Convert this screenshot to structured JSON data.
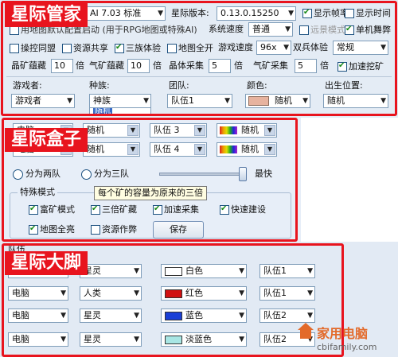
{
  "section1": {
    "badge": "星际管家",
    "row1": {
      "version_select": "AI 7.03 标准",
      "sc_version_label": "星际版本:",
      "sc_version_value": "0.13.0.15250",
      "show_fps": "显示帧率",
      "show_time": "显示时间"
    },
    "row2": {
      "hidden_text": "用地图默认配置启动 (用于RPG地图或特殊AI)",
      "system_speed_label": "系统速度",
      "system_speed_value": "普通",
      "distant_view": "远景模式",
      "single_machine": "单机舞弊"
    },
    "row3": {
      "macro": "操控同盟",
      "resource_share": "资源共享",
      "three_race": "三族体验",
      "map_full_open": "地图全开",
      "game_speed_label": "游戏速度",
      "game_speed_value": "96x",
      "double_soldier_label": "双兵体验",
      "double_soldier_value": "常规"
    },
    "row4": {
      "mineral_label": "晶矿蕴藏",
      "mineral_value": "10",
      "gas_label": "气矿蕴藏",
      "gas_value": "10",
      "crystal_collect_label": "晶体采集",
      "crystal_collect_value": "5",
      "gas_collect_label": "气矿采集",
      "gas_collect_value": "5",
      "times": "倍",
      "speed_mining": "加速挖矿"
    },
    "row5": {
      "player_label": "游戏者:",
      "player_value": "游戏者",
      "race_label": "种族:",
      "race_value": "神族",
      "team_label": "团队:",
      "team_value": "队伍1",
      "color_label": "颜色:",
      "color_value": "随机",
      "spawn_label": "出生位置:",
      "spawn_value": "随机",
      "popup_fragment": "随机"
    }
  },
  "section2": {
    "badge": "星际盒子",
    "rows": [
      {
        "player": "电脑",
        "race": "随机",
        "team": "队伍 3",
        "color": "随机"
      },
      {
        "player": "电脑",
        "race": "随机",
        "team": "队伍 4",
        "color": "随机"
      }
    ],
    "radio_two": "分为两队",
    "radio_three": "分为三队",
    "slider_max": "最快",
    "special_mode": "特殊模式",
    "tooltip": "每个矿的容量为原来的三倍",
    "rich_mine": "富矿模式",
    "triple_mine": "三倍矿藏",
    "fast_collect": "加速采集",
    "fast_build": "快速建设",
    "map_reveal": "地图全亮",
    "resource_cheat": "资源作弊",
    "save": "保存",
    "colors": {
      "accent": "#e8141e",
      "panel": "#e4ecf5"
    }
  },
  "section3": {
    "badge": "星际大脚",
    "header": "队伍",
    "rows": [
      {
        "player": "观察",
        "race": "星灵",
        "color": "白色",
        "swatch": "#ffffff",
        "team": "队伍1"
      },
      {
        "player": "电脑",
        "race": "人类",
        "color": "红色",
        "swatch": "#d11010",
        "team": "队伍1"
      },
      {
        "player": "电脑",
        "race": "星灵",
        "color": "蓝色",
        "swatch": "#1a3fd6",
        "team": "队伍2"
      },
      {
        "player": "电脑",
        "race": "星灵",
        "color": "淡蓝色",
        "swatch": "#a8e6e4",
        "team": "队伍2"
      }
    ]
  },
  "watermark": {
    "cn": "家用电脑",
    "url": "cbifamily.com"
  }
}
